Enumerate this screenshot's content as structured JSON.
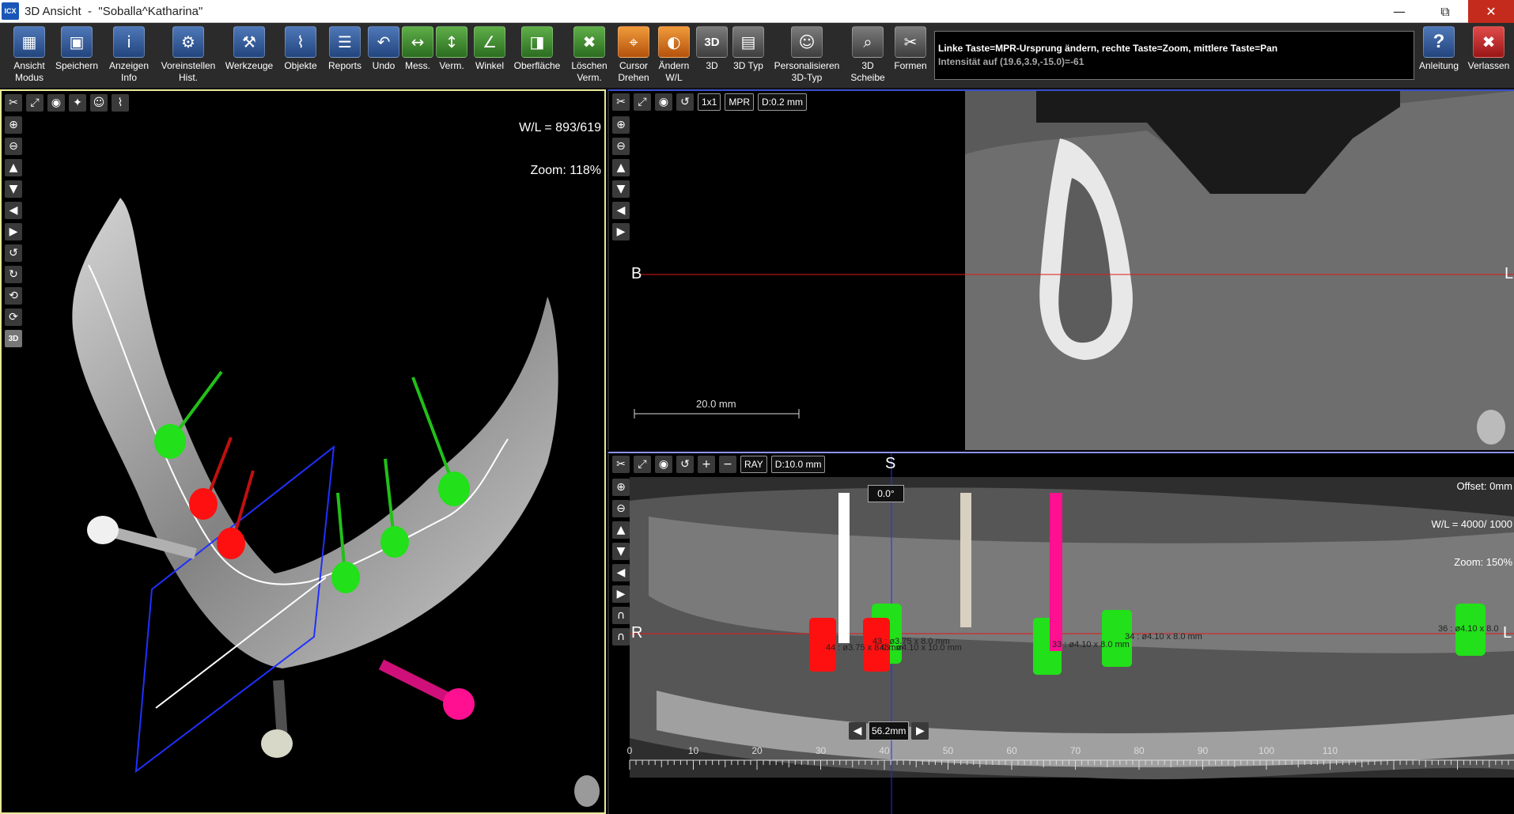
{
  "window": {
    "logo": "ICX",
    "title": "3D Ansicht  -  \"Soballa^Katharina\"",
    "controls": {
      "minimize": "—",
      "maximize": "⧉",
      "close": "✕"
    }
  },
  "toolbar": {
    "buttons": [
      {
        "label": "Ansicht\nModus",
        "icon": "view-mode-icon",
        "glyph": "▦"
      },
      {
        "label": "Speichern",
        "icon": "save-icon",
        "glyph": "▣"
      },
      {
        "label": "Anzeigen\nInfo",
        "icon": "info-icon",
        "glyph": "i"
      },
      {
        "label": "Voreinstellen\nHist.",
        "icon": "histogram-preset-icon",
        "glyph": "⚙"
      },
      {
        "label": "Werkzeuge",
        "icon": "tools-icon",
        "glyph": "⚒"
      },
      {
        "label": "Objekte",
        "icon": "objects-icon",
        "glyph": "⌇"
      },
      {
        "label": "Reports",
        "icon": "reports-icon",
        "glyph": "☰"
      },
      {
        "label": "Undo",
        "icon": "undo-icon",
        "glyph": "↶"
      },
      {
        "label": "Mess.",
        "icon": "measure-icon",
        "glyph": "↔"
      },
      {
        "label": "Verm.",
        "icon": "dimension-icon",
        "glyph": "↕"
      },
      {
        "label": "Winkel",
        "icon": "angle-icon",
        "glyph": "∠"
      },
      {
        "label": "Oberfläche",
        "icon": "surface-icon",
        "glyph": "◨"
      },
      {
        "label": "Löschen\nVerm.",
        "icon": "trash-icon",
        "glyph": "✖"
      },
      {
        "label": "Cursor\nDrehen",
        "icon": "cursor-rotate-icon",
        "glyph": "⌖"
      },
      {
        "label": "Ändern\nW/L",
        "icon": "window-level-icon",
        "glyph": "◐"
      },
      {
        "label": "3D",
        "icon": "3d-icon",
        "glyph": "3D"
      },
      {
        "label": "3D Typ",
        "icon": "3d-type-icon",
        "glyph": "▤"
      },
      {
        "label": "Personalisieren\n3D-Typ",
        "icon": "personalize-icon",
        "glyph": "☺"
      },
      {
        "label": "3D\nScheibe",
        "icon": "3d-slice-icon",
        "glyph": "⌕"
      },
      {
        "label": "Formen",
        "icon": "scissors-icon",
        "glyph": "✂"
      },
      {
        "label": "Anleitung",
        "icon": "help-icon",
        "glyph": "?"
      },
      {
        "label": "Verlassen",
        "icon": "exit-icon",
        "glyph": "✖"
      }
    ],
    "info_line1": "Linke Taste=MPR-Ursprung ändern, rechte Taste=Zoom, mittlere Taste=Pan",
    "info_line2": "Intensität auf (19.6,3.9,-15.0)=-61"
  },
  "left_panel": {
    "wl": "W/L = 893/619",
    "zoom": "Zoom: 118%",
    "top_tools": [
      "✂",
      "⤢",
      "◉",
      "✦",
      "☺",
      "⌇"
    ],
    "side_tools": [
      "⊕",
      "⊖",
      "▲",
      "▼",
      "◀",
      "▶",
      "↺",
      "↻",
      "⟲",
      "⟳",
      "3D"
    ]
  },
  "top_right_panel": {
    "buttons": [
      "1x1",
      "MPR",
      "D:0.2 mm"
    ],
    "label_left": "B",
    "label_right": "L",
    "scale": "20.0 mm",
    "side_tools": [
      "⊕",
      "⊖",
      "▲",
      "▼",
      "◀",
      "▶"
    ]
  },
  "bottom_right_panel": {
    "buttons": [
      "RAY",
      "D:10.0 mm"
    ],
    "offset": "Offset: 0mm",
    "wl": "W/L = 4000/ 1000",
    "zoom": "Zoom: 150%",
    "label_s": "S",
    "label_r": "R",
    "label_l": "L",
    "angle": "0.0°",
    "position": "56.2mm",
    "ruler_ticks": [
      "0",
      "10",
      "20",
      "30",
      "40",
      "50",
      "60",
      "70",
      "80",
      "90",
      "100",
      "110"
    ],
    "implants": [
      "46 : ø4.10 x 10.0 mm",
      "44 : ø3.75 x 8.0 mm",
      "43 : ø3.75 x 8.0 mm",
      "33 : ø4.10 x 8.0 mm",
      "34 : ø4.10 x 8.0 mm",
      "36 : ø4.10 x 8.0"
    ],
    "side_tools": [
      "⊕",
      "⊖",
      "▲",
      "▼",
      "◀",
      "▶",
      "∩",
      "∩"
    ]
  },
  "colors": {
    "implant_green": "#22e01a",
    "implant_red": "#ff1010",
    "implant_pink": "#ff1090",
    "axis_red": "#e01818",
    "axis_blue": "#2030ff"
  }
}
